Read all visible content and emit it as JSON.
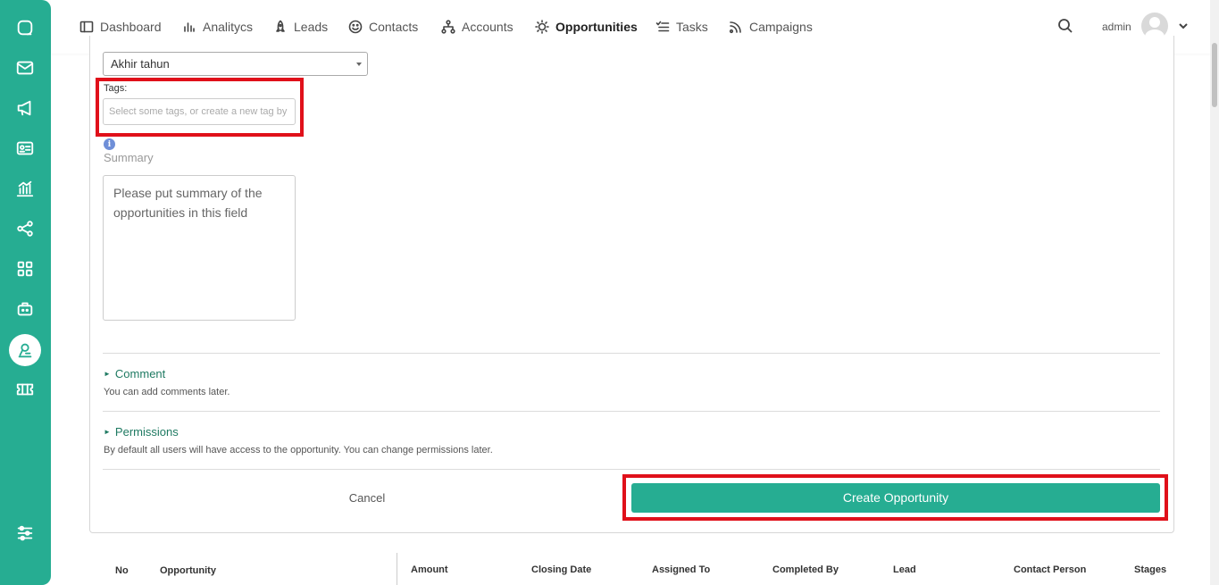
{
  "sidebar": {
    "icons": [
      "chat-icon",
      "mail-icon",
      "megaphone-icon",
      "contact-card-icon",
      "analytics-icon",
      "share-icon",
      "apps-grid-icon",
      "robot-icon",
      "opportunity-icon",
      "ticket-icon",
      "settings-sliders-icon"
    ],
    "active": "opportunity-icon"
  },
  "nav": {
    "items": [
      {
        "label": "Dashboard",
        "icon": "dashboard-icon"
      },
      {
        "label": "Analitycs",
        "icon": "bar-chart-icon"
      },
      {
        "label": "Leads",
        "icon": "rocket-icon"
      },
      {
        "label": "Contacts",
        "icon": "smile-icon"
      },
      {
        "label": "Accounts",
        "icon": "hierarchy-icon"
      },
      {
        "label": "Opportunities",
        "icon": "bulb-icon"
      },
      {
        "label": "Tasks",
        "icon": "checklist-icon"
      },
      {
        "label": "Campaigns",
        "icon": "rss-icon"
      }
    ],
    "active": "Opportunities",
    "user": "admin"
  },
  "form": {
    "select_value": "Akhir tahun",
    "tags_label": "Tags:",
    "tags_placeholder": "Select some tags, or create a new tag by",
    "summary_label": "Summary",
    "summary_placeholder": "Please put summary of the opportunities in this field",
    "comment_title": "Comment",
    "comment_note": "You can add comments later.",
    "permissions_title": "Permissions",
    "permissions_note": "By default all users will have access to the opportunity. You can change permissions later.",
    "cancel_label": "Cancel",
    "create_label": "Create Opportunity"
  },
  "table": {
    "headers": [
      "No",
      "Opportunity",
      "Amount",
      "Closing Date",
      "Assigned To",
      "Completed By",
      "Lead",
      "Contact Person",
      "Stages"
    ]
  },
  "colors": {
    "accent": "#26ad92",
    "highlight": "#e0101a",
    "section_text": "#1f7a62"
  }
}
